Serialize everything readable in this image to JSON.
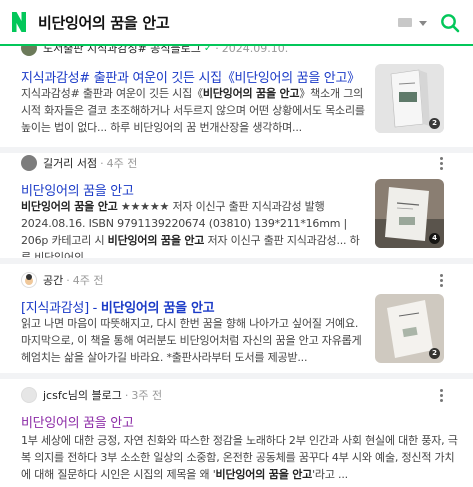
{
  "search": {
    "query": "비단잉어의 꿈을 안고"
  },
  "results": [
    {
      "source_name": "도서출판 지식과감성# 공식블로그",
      "source_verified": "✓",
      "date": "2024.09.10.",
      "title": "지식과감성# 출판과 여운이 깃든 시집《비단잉어의 꿈을 안고》",
      "desc": [
        {
          "t": "지식과감성# 출판과 여운이 깃든 시집《",
          "b": false
        },
        {
          "t": "비단잉어의 꿈을 안고",
          "b": true
        },
        {
          "t": "》책소개 그의 시적 화자들은 결코 초조해하거나 서두르지 않으며 어떤 상황에서도 목소리를 높이는 법이 없다... 하루 비단잉어의 꿈 번개산장을 생각하며...",
          "b": false
        }
      ],
      "thumb_count": "2"
    },
    {
      "source_name": "길거리 서점",
      "date": "4주 전",
      "title": "비단잉어의 꿈을 안고",
      "desc": [
        {
          "t": "비단잉어의 꿈을 안고",
          "b": true
        },
        {
          "t": " ★★★★★ 저자 이신구 출판 지식과감성 발행 2024.08.16. ISBN 9791139220674 (03810) 139*211*16mm | 206p 카테고리 시 ",
          "b": false
        },
        {
          "t": "비단잉어의 꿈을 안고",
          "b": true
        },
        {
          "t": " 저자 이신구 출판 지식과감성... 하루 비단잉어의",
          "b": false
        }
      ],
      "thumb_count": "4"
    },
    {
      "source_name": "공간",
      "date": "4주 전",
      "title": "[지식과감성] - 비단잉어의 꿈을 안고",
      "title_plain": "[지식과감성] - ",
      "title_bold": "비단잉어의 꿈을 안고",
      "desc": [
        {
          "t": "읽고 나면 마음이 따뜻해지고, 다시 한번 꿈을 향해 나아가고 싶어질 거예요. 마지막으로, 이 책을 통해 여러분도 비단잉어처럼 자신의 꿈을 안고 자유롭게 헤엄치는 삶을 살아가길 바라요. *출판사라부터 도서를 제공받...",
          "b": false
        }
      ],
      "thumb_count": "2"
    },
    {
      "source_name": "jcsfc님의 블로그",
      "date": "3주 전",
      "title": "비단잉어의 꿈을 안고",
      "desc": [
        {
          "t": "1부 세상에 대한 긍정, 자연 친화와 따스한 정감을 노래하다 2부 인간과 사회 현실에 대한 풍자, 극복 의지를 전하다 3부 소소한 일상의 소중함, 온전한 공동체를 꿈꾸다 4부 시와 예술, 정신적 가치에 대해 질문하다 시인은 시집의 제목을 왜 '",
          "b": false
        },
        {
          "t": "비단잉어의 꿈을 안고",
          "b": true
        },
        {
          "t": "'라고 ...",
          "b": false
        }
      ]
    }
  ],
  "colors": {
    "accent": "#03c75a",
    "link": "#1a3ac7",
    "visited": "#8b2aa6"
  }
}
